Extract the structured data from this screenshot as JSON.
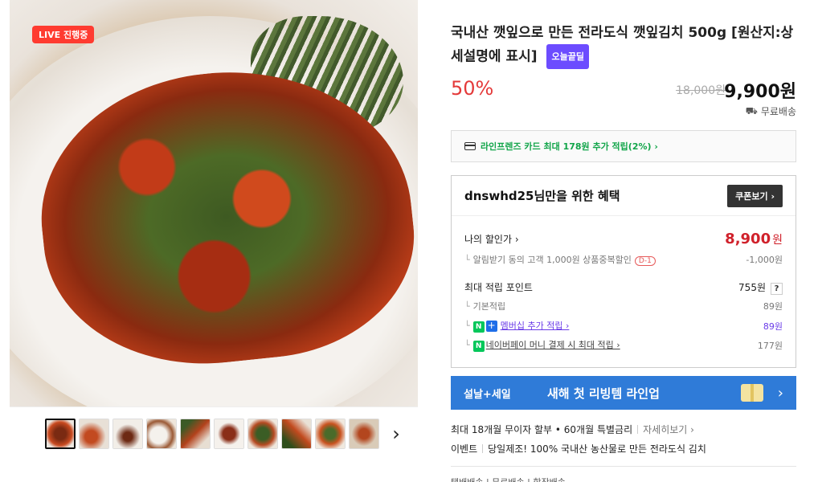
{
  "live_badge": {
    "label": "LIVE 진행중",
    "chevron": "›"
  },
  "product": {
    "title": "국내산 깻잎으로 만든 전라도식 깻잎김치 500g [원산지:상세설명에 표시]",
    "today_badge": "오늘끝딜",
    "discount": "50%",
    "original_price": "18,000원",
    "final_price": "9,900원",
    "shipping": "무료배송"
  },
  "card_promo": "라인프렌즈 카드 최대 178원 추가 적립(2%) ›",
  "benefit": {
    "title": "dnswhd25님만을 위한 혜택",
    "coupon_button": "쿠폰보기 ›",
    "my_price_label": "나의 할인가 ›",
    "my_price_value": "8,900",
    "my_price_unit": "원",
    "alarm_label": "알림받기 동의 고객 1,000원 상품중복할인",
    "alarm_dday": "D-1",
    "alarm_value": "-1,000원",
    "points_label": "최대 적립 포인트",
    "points_value": "755원",
    "points_help": "?",
    "basic_label": "기본적립",
    "basic_value": "89원",
    "membership_label": "멤버십 추가 적립 ›",
    "membership_value": "89원",
    "npay_label": "네이버페이 머니 결제 시 최대 적립 ›",
    "npay_value": "177원"
  },
  "banner": {
    "tag": "설날+세일",
    "text": "새해 첫 리빙템 라인업",
    "chevron": "›"
  },
  "info": {
    "installment": "최대 18개월 무이자 할부 • 60개월 특별금리",
    "installment_more": "자세히보기 ›",
    "event_label": "이벤트",
    "event_text": "당일제조! 100% 국내산 농산물로 만든 전라도식 김치"
  },
  "tabs_partial": "택배배송 | 무료배송 | 합작배송",
  "colors": {
    "discount": "#e43a3a",
    "today_badge": "#6c4cff",
    "card_green": "#12a54a",
    "banner_blue": "#2f7bd8",
    "price_red": "#d0212b"
  },
  "thumbnails": [
    "thumb-1",
    "thumb-2",
    "thumb-3",
    "thumb-4",
    "thumb-5",
    "thumb-6",
    "thumb-7",
    "thumb-8",
    "thumb-9",
    "thumb-10"
  ]
}
